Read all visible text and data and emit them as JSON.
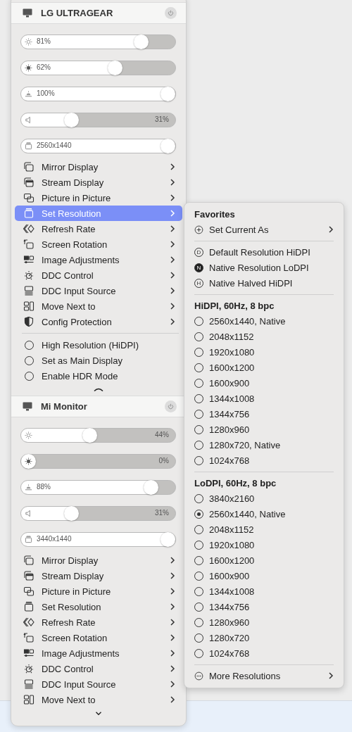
{
  "displays": [
    {
      "name": "LG ULTRAGEAR",
      "sliders": [
        {
          "kind": "brightness",
          "level": 0.81,
          "reading": "81%"
        },
        {
          "kind": "contrast",
          "level": 0.62,
          "reading": "62%"
        },
        {
          "kind": "color",
          "level": 1.0,
          "reading": "100%"
        },
        {
          "kind": "volume",
          "level": 0.31,
          "reading": "31%"
        },
        {
          "kind": "resolution",
          "level": 1.0,
          "reading": "2560x1440"
        }
      ],
      "menu": [
        {
          "kind": "mirror",
          "label": "Mirror Display",
          "selected": false
        },
        {
          "kind": "stream",
          "label": "Stream Display",
          "selected": false
        },
        {
          "kind": "pip",
          "label": "Picture in Picture",
          "selected": false
        },
        {
          "kind": "resolution",
          "label": "Set Resolution",
          "selected": true
        },
        {
          "kind": "refresh",
          "label": "Refresh Rate",
          "selected": false
        },
        {
          "kind": "rotation",
          "label": "Screen Rotation",
          "selected": false
        },
        {
          "kind": "image",
          "label": "Image Adjustments",
          "selected": false
        },
        {
          "kind": "ddc",
          "label": "DDC Control",
          "selected": false
        },
        {
          "kind": "input",
          "label": "DDC Input Source",
          "selected": false
        },
        {
          "kind": "move",
          "label": "Move Next to",
          "selected": false
        },
        {
          "kind": "protection",
          "label": "Config Protection",
          "selected": false
        }
      ],
      "toggles": [
        {
          "label": "High Resolution (HiDPI)",
          "checked": false
        },
        {
          "label": "Set as Main Display",
          "checked": false
        },
        {
          "label": "Enable HDR Mode",
          "checked": false
        }
      ],
      "scroll": {
        "kind": "up"
      }
    },
    {
      "name": "Mi Monitor",
      "sliders": [
        {
          "kind": "brightness",
          "level": 0.44,
          "reading": "44%"
        },
        {
          "kind": "contrast",
          "level": 0.0,
          "reading": "0%"
        },
        {
          "kind": "color",
          "level": 0.88,
          "reading": "88%"
        },
        {
          "kind": "volume",
          "level": 0.31,
          "reading": "31%"
        },
        {
          "kind": "resolution",
          "level": 1.0,
          "reading": "3440x1440"
        }
      ],
      "menu": [
        {
          "kind": "mirror",
          "label": "Mirror Display",
          "selected": false
        },
        {
          "kind": "stream",
          "label": "Stream Display",
          "selected": false
        },
        {
          "kind": "pip",
          "label": "Picture in Picture",
          "selected": false
        },
        {
          "kind": "resolution",
          "label": "Set Resolution",
          "selected": false
        },
        {
          "kind": "refresh",
          "label": "Refresh Rate",
          "selected": false
        },
        {
          "kind": "rotation",
          "label": "Screen Rotation",
          "selected": false
        },
        {
          "kind": "image",
          "label": "Image Adjustments",
          "selected": false
        },
        {
          "kind": "ddc",
          "label": "DDC Control",
          "selected": false
        },
        {
          "kind": "input",
          "label": "DDC Input Source",
          "selected": false
        },
        {
          "kind": "move",
          "label": "Move Next to",
          "selected": false
        }
      ],
      "scroll": {
        "kind": "down"
      }
    }
  ],
  "submenu": {
    "favorites_title": "Favorites",
    "set_current_label": "Set Current As",
    "favorites": [
      {
        "badge": "D",
        "label": "Default Resolution HiDPI",
        "selected": false
      },
      {
        "badge": "N",
        "label": "Native Resolution LoDPI",
        "selected": true
      },
      {
        "badge": "H",
        "label": "Native Halved HiDPI",
        "selected": false
      }
    ],
    "groups": [
      {
        "title": "HiDPI, 60Hz, 8 bpc",
        "items": [
          {
            "label": "2560x1440, Native",
            "selected": false
          },
          {
            "label": "2048x1152",
            "selected": false
          },
          {
            "label": "1920x1080",
            "selected": false
          },
          {
            "label": "1600x1200",
            "selected": false
          },
          {
            "label": "1600x900",
            "selected": false
          },
          {
            "label": "1344x1008",
            "selected": false
          },
          {
            "label": "1344x756",
            "selected": false
          },
          {
            "label": "1280x960",
            "selected": false
          },
          {
            "label": "1280x720, Native",
            "selected": false
          },
          {
            "label": "1024x768",
            "selected": false
          }
        ]
      },
      {
        "title": "LoDPI, 60Hz, 8 bpc",
        "items": [
          {
            "label": "3840x2160",
            "selected": false
          },
          {
            "label": "2560x1440, Native",
            "selected": true
          },
          {
            "label": "2048x1152",
            "selected": false
          },
          {
            "label": "1920x1080",
            "selected": false
          },
          {
            "label": "1600x1200",
            "selected": false
          },
          {
            "label": "1600x900",
            "selected": false
          },
          {
            "label": "1344x1008",
            "selected": false
          },
          {
            "label": "1344x756",
            "selected": false
          },
          {
            "label": "1280x960",
            "selected": false
          },
          {
            "label": "1280x720",
            "selected": false
          },
          {
            "label": "1024x768",
            "selected": false
          }
        ]
      }
    ],
    "more_label": "More Resolutions"
  }
}
